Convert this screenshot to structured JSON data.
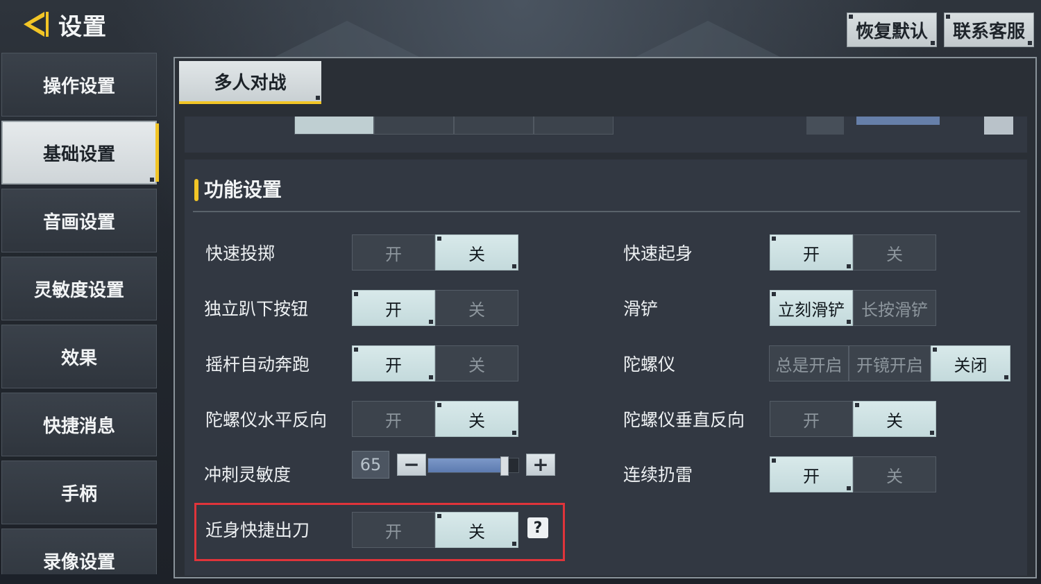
{
  "header": {
    "back_icon": "back-arrow-icon",
    "title": "设置",
    "restore_default": "恢复默认",
    "contact_support": "联系客服"
  },
  "sidebar": {
    "items": [
      {
        "label": "操作设置",
        "active": false
      },
      {
        "label": "基础设置",
        "active": true
      },
      {
        "label": "音画设置",
        "active": false
      },
      {
        "label": "灵敏度设置",
        "active": false
      },
      {
        "label": "效果",
        "active": false
      },
      {
        "label": "快捷消息",
        "active": false
      },
      {
        "label": "手柄",
        "active": false
      },
      {
        "label": "录像设置",
        "active": false
      }
    ]
  },
  "tabs": [
    {
      "label": "多人对战",
      "active": true
    }
  ],
  "section": {
    "title": "功能设置"
  },
  "rows": {
    "quick_throw": {
      "label": "快速投掷",
      "on": "开",
      "off": "关",
      "selected": "关"
    },
    "independent_prone": {
      "label": "独立趴下按钮",
      "on": "开",
      "off": "关",
      "selected": "开"
    },
    "joystick_auto_sprint": {
      "label": "摇杆自动奔跑",
      "on": "开",
      "off": "关",
      "selected": "开"
    },
    "gyro_h_invert": {
      "label": "陀螺仪水平反向",
      "on": "开",
      "off": "关",
      "selected": "关"
    },
    "sprint_sensitivity": {
      "label": "冲刺灵敏度",
      "value": "65",
      "level_percent": 65,
      "minus": "−",
      "plus": "+"
    },
    "melee_shortcut": {
      "label": "近身快捷出刀",
      "on": "开",
      "off": "关",
      "selected": "关",
      "help": "?"
    },
    "quick_getup": {
      "label": "快速起身",
      "on": "开",
      "off": "关",
      "selected": "开"
    },
    "slide": {
      "label": "滑铲",
      "option1": "立刻滑铲",
      "option2": "长按滑铲",
      "selected": "立刻滑铲"
    },
    "gyroscope": {
      "label": "陀螺仪",
      "option1": "总是开启",
      "option2": "开镜开启",
      "option3": "关闭",
      "selected": "关闭"
    },
    "gyro_v_invert": {
      "label": "陀螺仪垂直反向",
      "on": "开",
      "off": "关",
      "selected": "关"
    },
    "continuous_grenade": {
      "label": "连续扔雷",
      "on": "开",
      "off": "关",
      "selected": "开"
    }
  },
  "colors": {
    "accent": "#f2c526",
    "highlight": "#e0343a",
    "selected_segment": "#cfe3e4"
  }
}
